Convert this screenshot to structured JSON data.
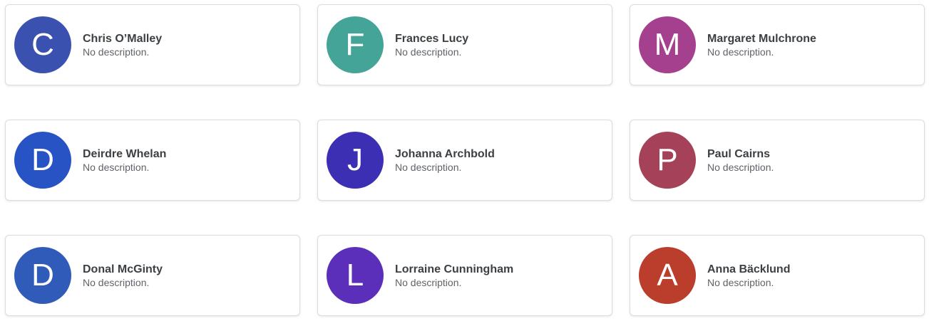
{
  "people": [
    {
      "initial": "C",
      "name": "Chris O’Malley",
      "description": "No description.",
      "color": "#3b51b0"
    },
    {
      "initial": "F",
      "name": "Frances Lucy",
      "description": "No description.",
      "color": "#44a498"
    },
    {
      "initial": "M",
      "name": "Margaret Mulchrone",
      "description": "No description.",
      "color": "#a5408f"
    },
    {
      "initial": "D",
      "name": "Deirdre Whelan",
      "description": "No description.",
      "color": "#2753c5"
    },
    {
      "initial": "J",
      "name": "Johanna Archbold",
      "description": "No description.",
      "color": "#3c2fb4"
    },
    {
      "initial": "P",
      "name": "Paul Cairns",
      "description": "No description.",
      "color": "#a54158"
    },
    {
      "initial": "D",
      "name": "Donal McGinty",
      "description": "No description.",
      "color": "#305bb8"
    },
    {
      "initial": "L",
      "name": "Lorraine Cunningham",
      "description": "No description.",
      "color": "#5b2fba"
    },
    {
      "initial": "A",
      "name": "Anna Bäcklund",
      "description": "No description.",
      "color": "#bb3d2c"
    }
  ]
}
